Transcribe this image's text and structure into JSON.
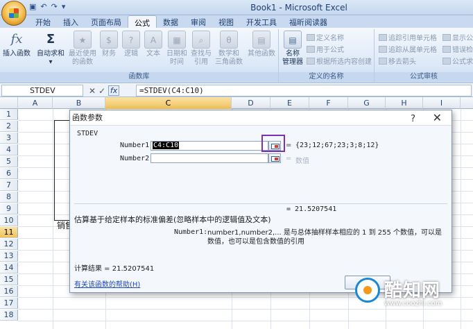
{
  "window": {
    "title": "Book1 - Microsoft Excel"
  },
  "qat": {
    "save_icon": "save-icon",
    "undo_icon": "undo-icon",
    "redo_icon": "redo-icon"
  },
  "tabs": [
    "开始",
    "插入",
    "页面布局",
    "公式",
    "数据",
    "审阅",
    "视图",
    "开发工具",
    "福昕阅读器"
  ],
  "active_tab": "公式",
  "ribbon": {
    "group_library": "函数库",
    "group_names": "定义的名称",
    "group_audit": "公式审核",
    "insert_function": "插入函数",
    "insert_function_icon": "fx",
    "autosum": "自动求和",
    "autosum_icon": "Σ",
    "recent_1": "最近使用",
    "recent_2": "的函数",
    "finance": "财务",
    "logic": "逻辑",
    "text": "文本",
    "datetime_1": "日期和",
    "datetime_2": "时间",
    "lookup_1": "查找与",
    "lookup_2": "引用",
    "math_1": "数学和",
    "math_2": "三角函数",
    "other": "其他函数",
    "name_manager_1": "名称",
    "name_manager_2": "管理器",
    "define_name": "定义名称",
    "use_in_formula": "用于公式",
    "create_from_selection": "根据所选内容创建",
    "trace_precedents": "追踪引用单元格",
    "trace_dependents": "追踪从属单元格",
    "remove_arrows": "移去箭头",
    "show_formulas": "显示公",
    "error_check": "错误检",
    "evaluate": "公式求"
  },
  "formula_bar": {
    "name_box": "STDEV",
    "cancel": "✕",
    "enter": "✓",
    "fx": "fx",
    "formula": "=STDEV(C4:C10)"
  },
  "grid": {
    "columns": [
      "A",
      "B",
      "C",
      "D",
      "E",
      "F",
      "G",
      "H",
      "I"
    ],
    "selected_column": "C",
    "rows": [
      "1",
      "2",
      "3",
      "4",
      "5",
      "6",
      "7",
      "8",
      "9",
      "10",
      "11",
      "12",
      "13",
      "14",
      "15",
      "16",
      "17",
      "18"
    ],
    "selected_row": "11",
    "b11_text": "销售"
  },
  "dialog": {
    "title": "函数参数",
    "help": "?",
    "close": "✕",
    "function_name": "STDEV",
    "arg1_label": "Number1",
    "arg1_value": "C4:C10",
    "arg1_result": "{23;12;67;23;3;8;12}",
    "arg2_label": "Number2",
    "arg2_result": "数值",
    "equals": "=",
    "result_line": "=  21.5207541",
    "description": "估算基于给定样本的标准偏差(忽略样本中的逻辑值及文本)",
    "arg_desc_name": "Number1:",
    "arg_desc_text": "number1,number2,... 是与总体抽样样本相应的 1 到 255 个数值，可以是数值，也可以是包含数值的引用",
    "calc_result": "计算结果 =  21.5207541",
    "help_link": "有关该函数的帮助(H)"
  },
  "watermark": {
    "name": "酷知网",
    "url": "www.coozhi.com"
  }
}
